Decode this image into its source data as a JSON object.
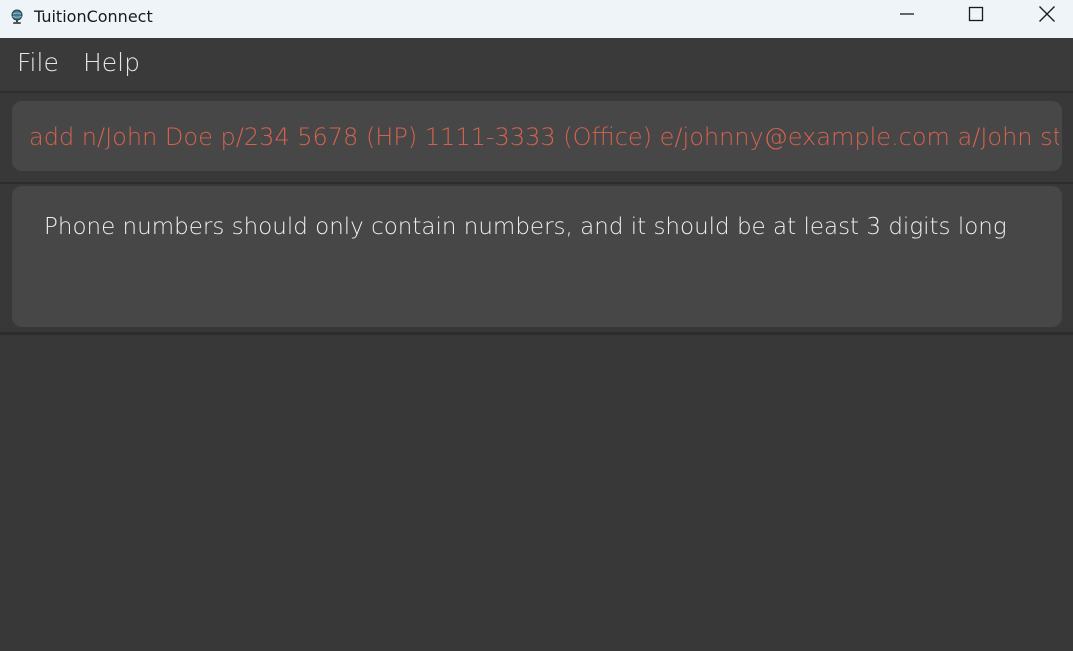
{
  "window": {
    "title": "TuitionConnect",
    "icon": "globe-icon"
  },
  "titlebar_controls": {
    "minimize_icon": "minimize-icon",
    "maximize_icon": "maximize-icon",
    "close_icon": "close-icon"
  },
  "menu": {
    "items": [
      {
        "label": "File"
      },
      {
        "label": "Help"
      }
    ]
  },
  "command": {
    "value": "add n/John Doe p/234 5678 (HP) 1111-3333 (Office) e/johnny@example.com a/John street, blc",
    "error_color": "#d5624f"
  },
  "result": {
    "message": "Phone numbers should only contain numbers, and it should be at least 3 digits long"
  },
  "colors": {
    "background": "#383838",
    "panel": "#474747",
    "titlebar": "#eff4f9",
    "text": "#f0f0f0"
  }
}
